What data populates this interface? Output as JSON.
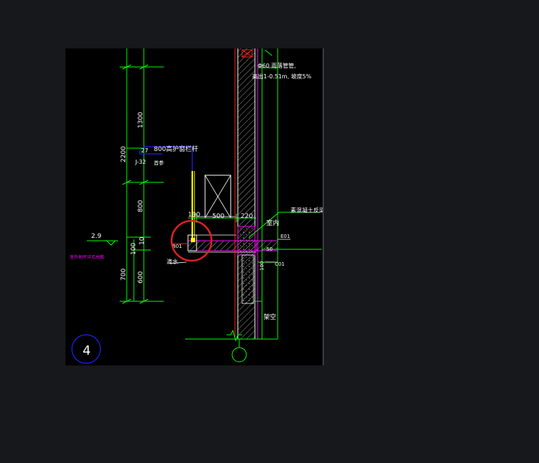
{
  "colors": {
    "background": "#17181b",
    "canvas": "#000000",
    "dim_green": "#00ff00",
    "wall_red": "#ff2020",
    "railing_blue": "#2020ff",
    "text_white": "#ffffff",
    "hatch_white": "#d0d0d0",
    "highlight_circle": "#e02020",
    "magenta": "#ff00ff",
    "yellow": "#ffff00"
  },
  "annotations": {
    "pipe_note_line1": "Φ60 雨落管管,",
    "pipe_note_line2": "高出1-0.51m, 坡度5%",
    "railing_note": "800高护窗栏杆",
    "railing_label_num": "27",
    "railing_label_code": "J-32",
    "railing_label_suffix": "首参",
    "concrete_note": "素混凝土反梁",
    "room_label": "室内",
    "void_label": "架空",
    "drain_label": "滴水",
    "left_small_label": "B01",
    "level_mark": "2.9",
    "magenta_note": "室外地坪详见总图",
    "e01_label": "E01",
    "c01_label": "C01",
    "drawing_number": "4"
  },
  "dimensions": {
    "total_height": "2200",
    "upper_height": "1300",
    "mid_height": "800",
    "small_100": "100",
    "small_10": "10",
    "lower_total": "700",
    "lower_600": "600",
    "width_190": "190",
    "width_500": "500",
    "width_220": "220",
    "right_50": "50",
    "right_100": "100"
  },
  "icons": [
    "circle-marker-icon",
    "break-line-icon",
    "level-triangle-icon"
  ]
}
